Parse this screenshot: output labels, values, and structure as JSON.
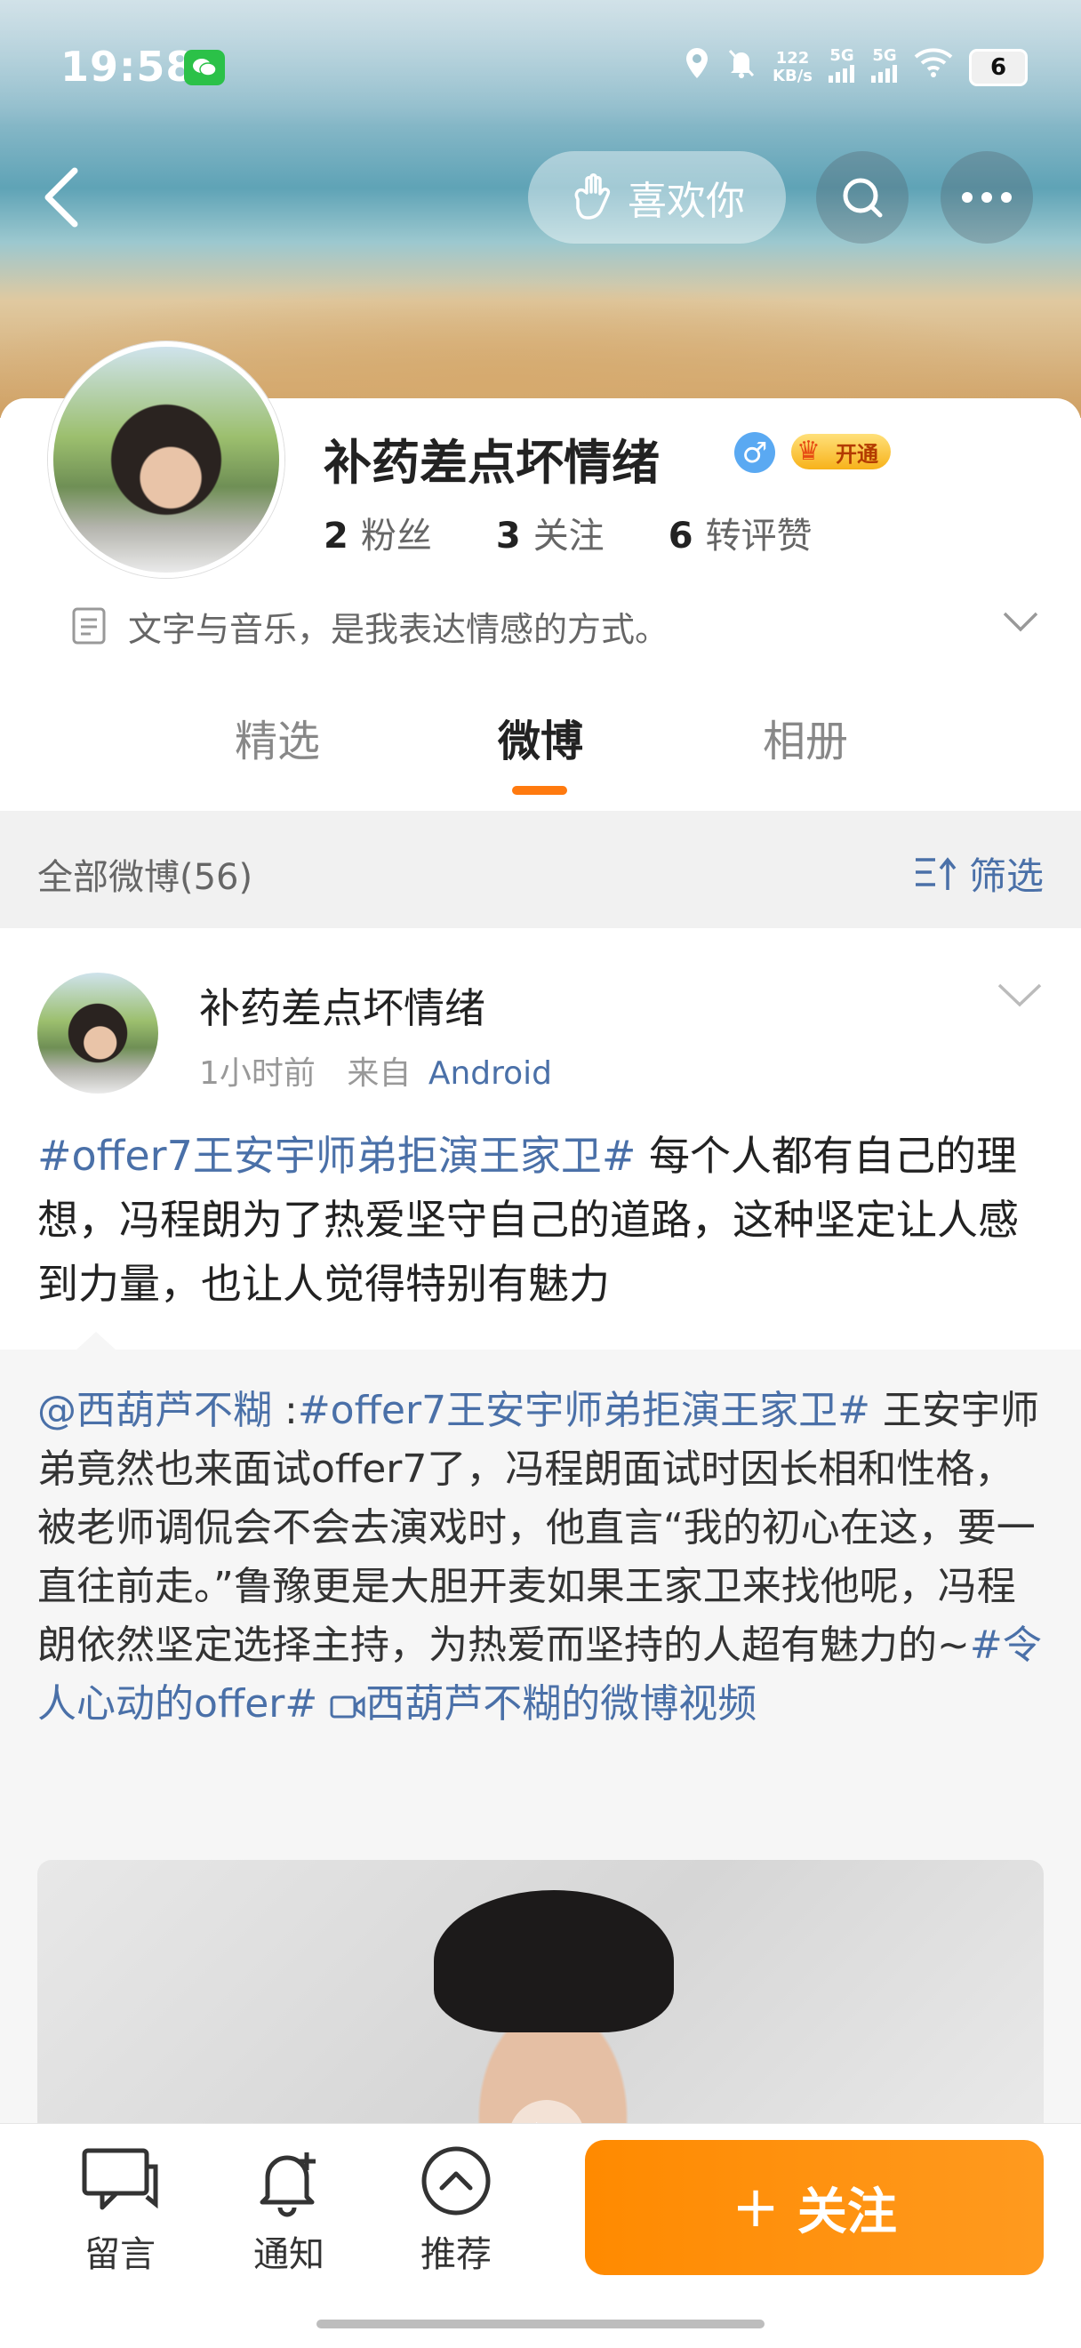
{
  "status_bar": {
    "time": "19:58",
    "net_speed_top": "122",
    "net_speed_bottom": "KB/s",
    "signal1": "5G",
    "signal2": "5G",
    "battery": "6"
  },
  "nav": {
    "like_label": "喜欢你"
  },
  "profile": {
    "name": "补药差点坏情绪",
    "gender": "♂",
    "vip_label": "开通",
    "stats": [
      {
        "num": "2",
        "label": "粉丝"
      },
      {
        "num": "3",
        "label": "关注"
      },
      {
        "num": "6",
        "label": "转评赞"
      }
    ],
    "bio": "文字与音乐，是我表达情感的方式。"
  },
  "tabs": [
    {
      "label": "精选"
    },
    {
      "label": "微博"
    },
    {
      "label": "相册"
    }
  ],
  "filter": {
    "all_label": "全部微博(56)",
    "filter_label": "筛选"
  },
  "post": {
    "author": "补药差点坏情绪",
    "time": "1小时前",
    "from_label": "来自",
    "source": "Android",
    "topic": "#offer7王安宇师弟拒演王家卫#",
    "text": " 每个人都有自己的理想，冯程朗为了热爱坚守自己的道路，这种坚定让人感到力量，也让人觉得特别有魅力",
    "repost": {
      "mention": "@西葫芦不糊",
      "colon": " :",
      "topic": "#offer7王安宇师弟拒演王家卫#",
      "text": " 王安宇师弟竟然也来面试offer7了，冯程朗面试时因长相和性格，被老师调侃会不会去演戏时，他直言“我的初心在这，要一直往前走。”鲁豫更是大胆开麦如果王家卫来找他呢，冯程朗依然坚定选择主持，为热爱而坚持的人超有魅力的~",
      "topic2": "#令人心动的offer#",
      "video_link": "西葫芦不糊的微博视频"
    }
  },
  "bottom_bar": {
    "comment_label": "留言",
    "notify_label": "通知",
    "recommend_label": "推荐",
    "follow_label": "关注",
    "follow_plus": "+"
  }
}
